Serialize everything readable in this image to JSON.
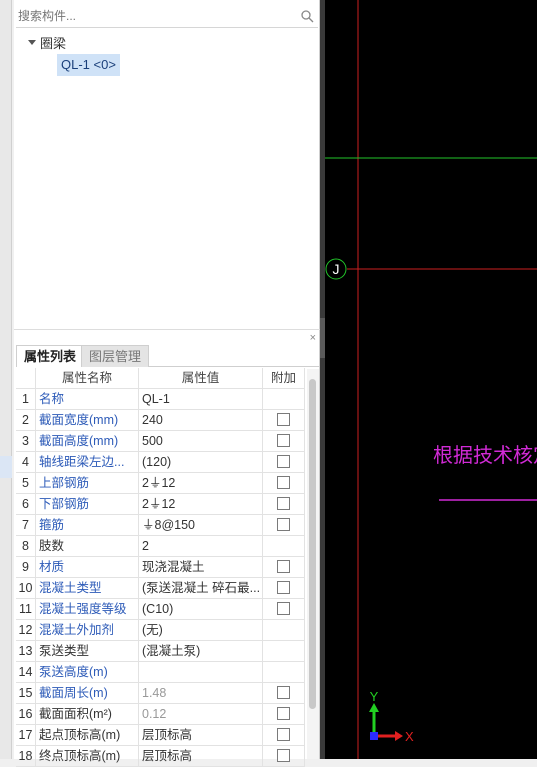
{
  "search": {
    "placeholder": "搜索构件..."
  },
  "tree": {
    "group_label": "圈梁",
    "item_label": "QL-1 <0>"
  },
  "tabs": [
    {
      "label": "属性列表"
    },
    {
      "label": "图层管理"
    }
  ],
  "close_glyph": "×",
  "grid": {
    "headers": {
      "name": "属性名称",
      "value": "属性值",
      "extra": "附加"
    },
    "rows": [
      {
        "num": "1",
        "name": "名称",
        "value": "QL-1",
        "checkbox": false
      },
      {
        "num": "2",
        "name": "截面宽度(mm)",
        "value": "240",
        "checkbox": true
      },
      {
        "num": "3",
        "name": "截面高度(mm)",
        "value": "500",
        "checkbox": true
      },
      {
        "num": "4",
        "name": "轴线距梁左边...",
        "value": "(120)",
        "checkbox": true
      },
      {
        "num": "5",
        "name": "上部钢筋",
        "value": "2⏚12",
        "checkbox": true
      },
      {
        "num": "6",
        "name": "下部钢筋",
        "value": "2⏚12",
        "checkbox": true
      },
      {
        "num": "7",
        "name": "箍筋",
        "value": "⏚8@150",
        "checkbox": true
      },
      {
        "num": "8",
        "name": "肢数",
        "value": "2",
        "checkbox": false
      },
      {
        "num": "9",
        "name": "材质",
        "value": "现浇混凝土",
        "checkbox": true
      },
      {
        "num": "10",
        "name": "混凝土类型",
        "value": "(泵送混凝土 碎石最...",
        "checkbox": true
      },
      {
        "num": "11",
        "name": "混凝土强度等级",
        "value": "(C10)",
        "checkbox": true
      },
      {
        "num": "12",
        "name": "混凝土外加剂",
        "value": "(无)",
        "checkbox": false
      },
      {
        "num": "13",
        "name": "泵送类型",
        "value": "(混凝土泵)",
        "checkbox": false
      },
      {
        "num": "14",
        "name": "泵送高度(m)",
        "value": "",
        "checkbox": false
      },
      {
        "num": "15",
        "name": "截面周长(m)",
        "value": "1.48",
        "checkbox": true
      },
      {
        "num": "16",
        "name": "截面面积(m²)",
        "value": "0.12",
        "checkbox": true
      },
      {
        "num": "17",
        "name": "起点顶标高(m)",
        "value": "层顶标高",
        "checkbox": true
      },
      {
        "num": "18",
        "name": "终点顶标高(m)",
        "value": "层顶标高",
        "checkbox": true
      }
    ]
  },
  "canvas": {
    "axis_label": "J",
    "annotation_text": "根据技术核定单",
    "coord_x_label": "X",
    "coord_y_label": "Y",
    "colors": {
      "background": "#000000",
      "axis_line_red": "#cc1f1f",
      "axis_line_green": "#22c42a",
      "annotation_magenta": "#d12ad6",
      "coord_x": "#e02020",
      "coord_y": "#22d022"
    }
  }
}
